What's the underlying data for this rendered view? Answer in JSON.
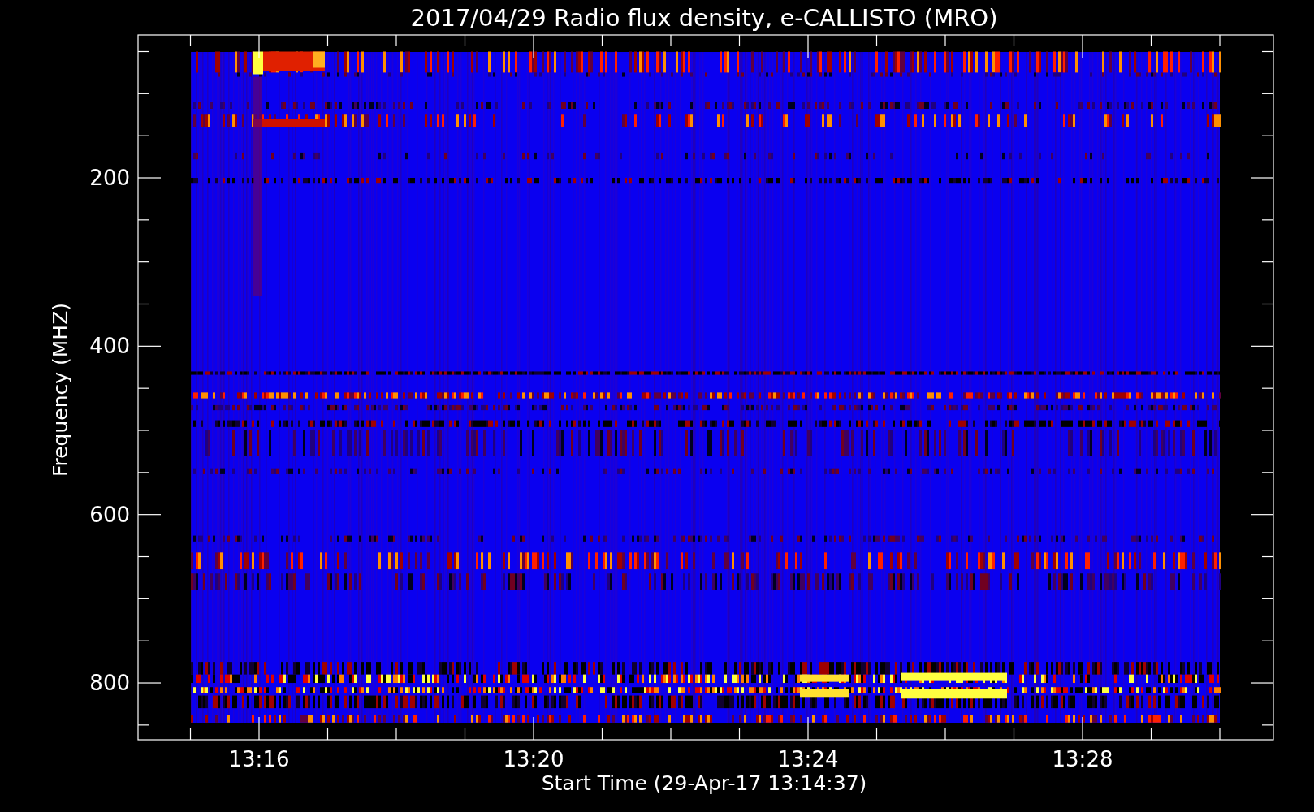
{
  "title": "2017/04/29  Radio flux density, e-CALLISTO (MRO)",
  "plot": {
    "ylabel": "Frequency (MHZ)",
    "xlabel": "Start Time (29-Apr-17 13:14:37)",
    "yticks": [
      "200",
      "400",
      "600",
      "800"
    ],
    "xticks": [
      "13:16",
      "13:20",
      "13:24",
      "13:28"
    ]
  }
}
